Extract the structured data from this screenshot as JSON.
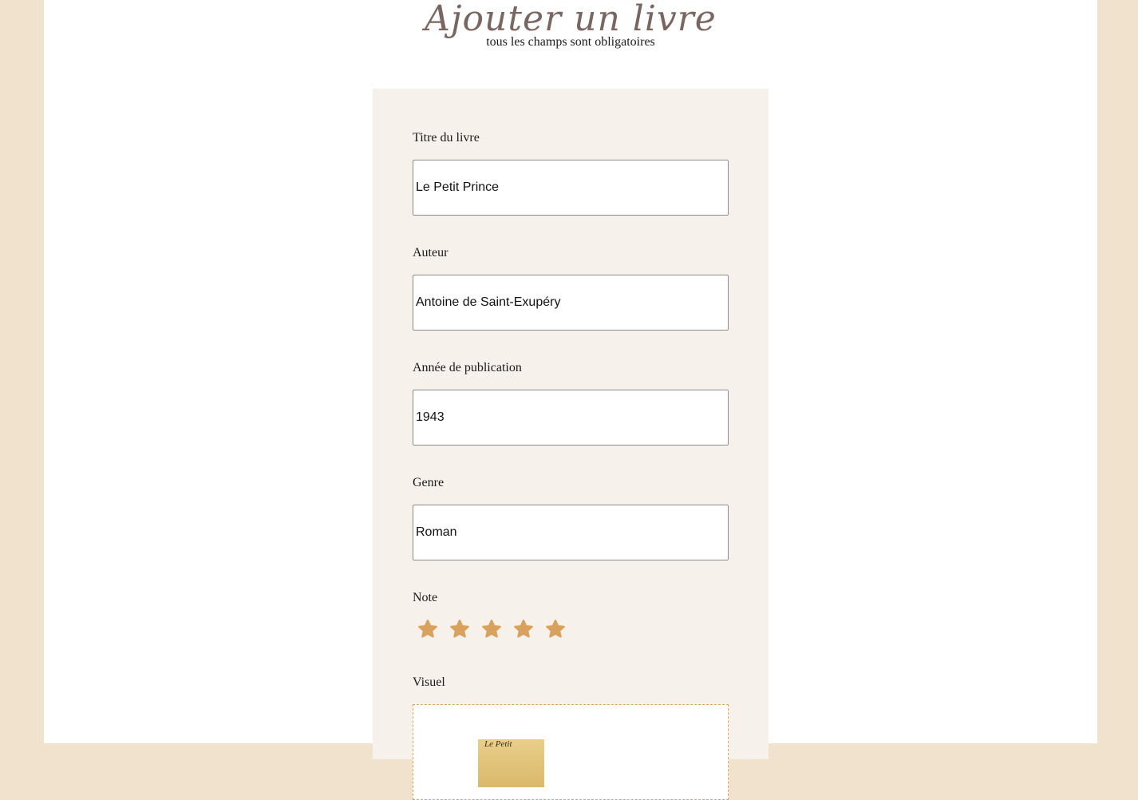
{
  "header": {
    "title": "Ajouter un livre",
    "subtitle": "tous les champs sont obligatoires"
  },
  "form": {
    "title_label": "Titre du livre",
    "title_value": "Le Petit Prince",
    "author_label": "Auteur",
    "author_value": "Antoine de Saint-Exupéry",
    "year_label": "Année de publication",
    "year_value": "1943",
    "genre_label": "Genre",
    "genre_value": "Roman",
    "rating_label": "Note",
    "rating": {
      "value": 5,
      "max": 5,
      "icon": "star-icon"
    },
    "visual_label": "Visuel",
    "cover_preview_text": "Le Petit"
  },
  "colors": {
    "page_margin": "#F0E2CD",
    "form_background": "#F6F1EB",
    "title_color": "#7A6661",
    "star_color": "#D9A15E",
    "drop_border": "#D9A15E"
  }
}
